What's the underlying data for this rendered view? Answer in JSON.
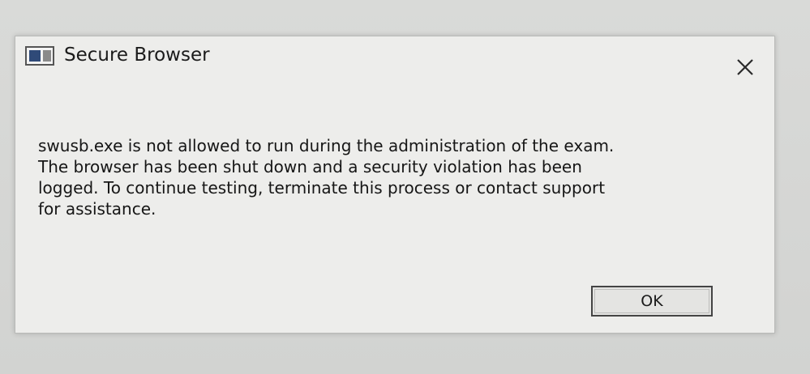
{
  "dialog": {
    "title": "Secure Browser",
    "message": "swusb.exe is not allowed to run during the administration of the exam.\nThe browser has been shut down and a security violation has been\nlogged. To continue testing, terminate this process or contact support\nfor assistance.",
    "ok_label": "OK",
    "icons": {
      "app": "secure-browser-app-icon",
      "close": "close-icon"
    }
  }
}
